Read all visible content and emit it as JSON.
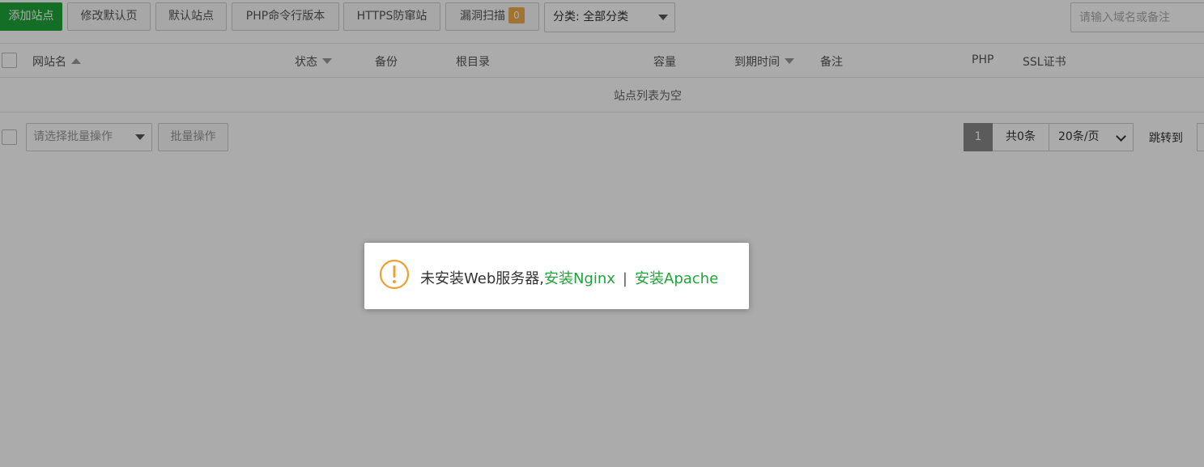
{
  "toolbar": {
    "add_site": "添加站点",
    "modify_default_page": "修改默认页",
    "default_site": "默认站点",
    "php_cli_version": "PHP命令行版本",
    "https_protect": "HTTPS防窜站",
    "vuln_scan": "漏洞扫描",
    "vuln_count": "0",
    "category_select": "分类: 全部分类",
    "search_placeholder": "请输入域名或备注"
  },
  "table": {
    "headers": {
      "site_name": "网站名",
      "status": "状态",
      "backup": "备份",
      "root_dir": "根目录",
      "capacity": "容量",
      "expire": "到期时间",
      "remark": "备注",
      "php": "PHP",
      "ssl": "SSL证书"
    },
    "empty_text": "站点列表为空"
  },
  "footer": {
    "batch_select_placeholder": "请选择批量操作",
    "batch_button": "批量操作",
    "current_page": "1",
    "total": "共0条",
    "page_size": "20条/页",
    "jump_label": "跳转到"
  },
  "dialog": {
    "message": "未安装Web服务器,",
    "install_nginx": "安装Nginx",
    "separator": "|",
    "install_apache": "安装Apache"
  },
  "colors": {
    "accent_green": "#20a53a",
    "badge_orange": "#f0ad4e",
    "warning_icon": "#f0a030",
    "overlay": "rgba(0,0,0,0.33)"
  },
  "icons": {
    "dialog_icon": "warning-exclamation-icon",
    "sort_asc": "caret-up-icon",
    "sort_desc": "caret-down-icon"
  }
}
